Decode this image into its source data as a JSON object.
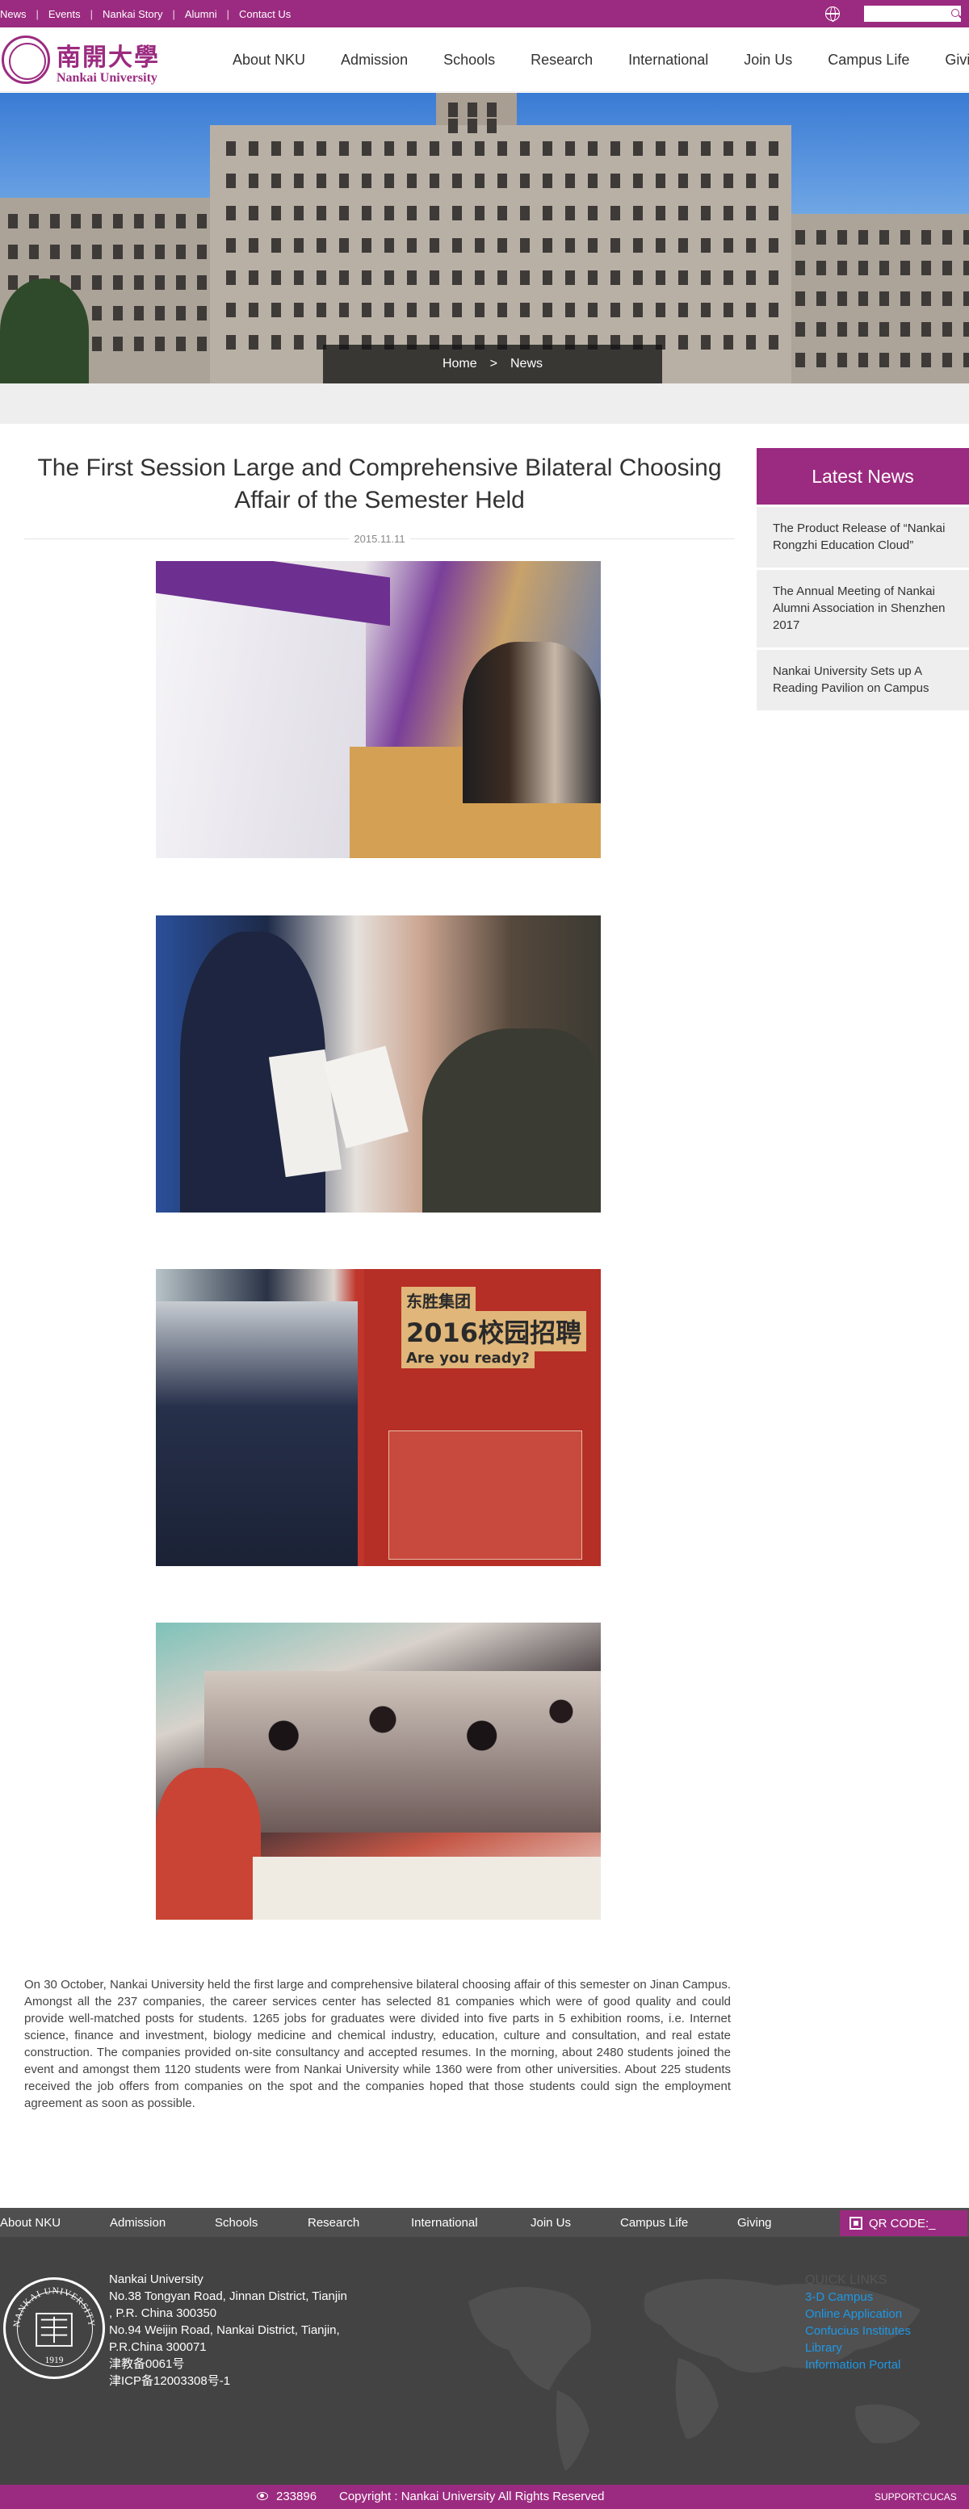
{
  "topbar": {
    "links": [
      "News",
      "Events",
      "Nankai Story",
      "Alumni",
      "Contact Us"
    ]
  },
  "header": {
    "logo_cn": "南開大學",
    "logo_en": "Nankai University",
    "nav": [
      "About NKU",
      "Admission",
      "Schools",
      "Research",
      "International",
      "Join Us",
      "Campus Life",
      "Giving"
    ]
  },
  "breadcrumb": {
    "home": "Home",
    "separator": ">",
    "current": "News"
  },
  "article": {
    "title": "The First Session Large and Comprehensive Bilateral Choosing Affair of the Semester Held",
    "date": "2015.11.11",
    "body": "On 30 October, Nankai University held the first large and comprehensive bilateral choosing affair of this semester on Jinan Campus. Amongst all the 237 companies, the career services center has selected 81 companies which were of good quality and could provide well-matched posts for students. 1265 jobs for graduates were divided into five parts in 5 exhibition rooms, i.e. Internet science, finance and investment, biology medicine and chemical industry, education, culture and consultation, and real estate construction. The companies provided on-site consultancy and accepted resumes. In the morning, about 2480 students joined the event and amongst them 1120 students were from Nankai University while 1360 were from other universities. About 225 students received the job offers from companies on the spot and the companies hoped that those students could sign the employment agreement as soon as possible.",
    "photo3_sign_line1": "东胜集团",
    "photo3_sign_line2": "2016校园招聘",
    "photo3_sign_line3": "Are you ready?"
  },
  "sidebar": {
    "heading": "Latest News",
    "items": [
      "The Product Release of “Nankai Rongzhi Education Cloud”",
      "The Annual Meeting of Nankai Alumni Association in Shenzhen 2017",
      "Nankai University Sets up A Reading Pavilion on Campus"
    ]
  },
  "footer_nav": {
    "items": [
      "About NKU",
      "Admission",
      "Schools",
      "Research",
      "International",
      "Join Us",
      "Campus Life",
      "Giving"
    ],
    "qr_label": "QR CODE:_"
  },
  "footer": {
    "address_lines": [
      "Nankai University",
      "No.38 Tongyan Road, Jinnan District, Tianjin",
      ", P.R. China 300350",
      "No.94 Weijin Road,  Nankai District, Tianjin,",
      "P.R.China  300071",
      "津教备0061号",
      "津ICP备12003308号-1"
    ],
    "quick_heading": "QUICK LINKS",
    "quick_links": [
      "3-D Campus",
      "Online Application",
      "Confucius Institutes",
      "Library",
      "Information Portal"
    ],
    "seal_text_top": "NANKAI UNIVERSITY",
    "seal_year": "1919"
  },
  "copyright": {
    "visits": "233896",
    "text": "Copyright : Nankai University All Rights Reserved",
    "support": "SUPPORT:CUCAS"
  },
  "colors": {
    "brand": "#9b2b80",
    "link": "#1e98e6",
    "footer_bg": "#434343"
  }
}
